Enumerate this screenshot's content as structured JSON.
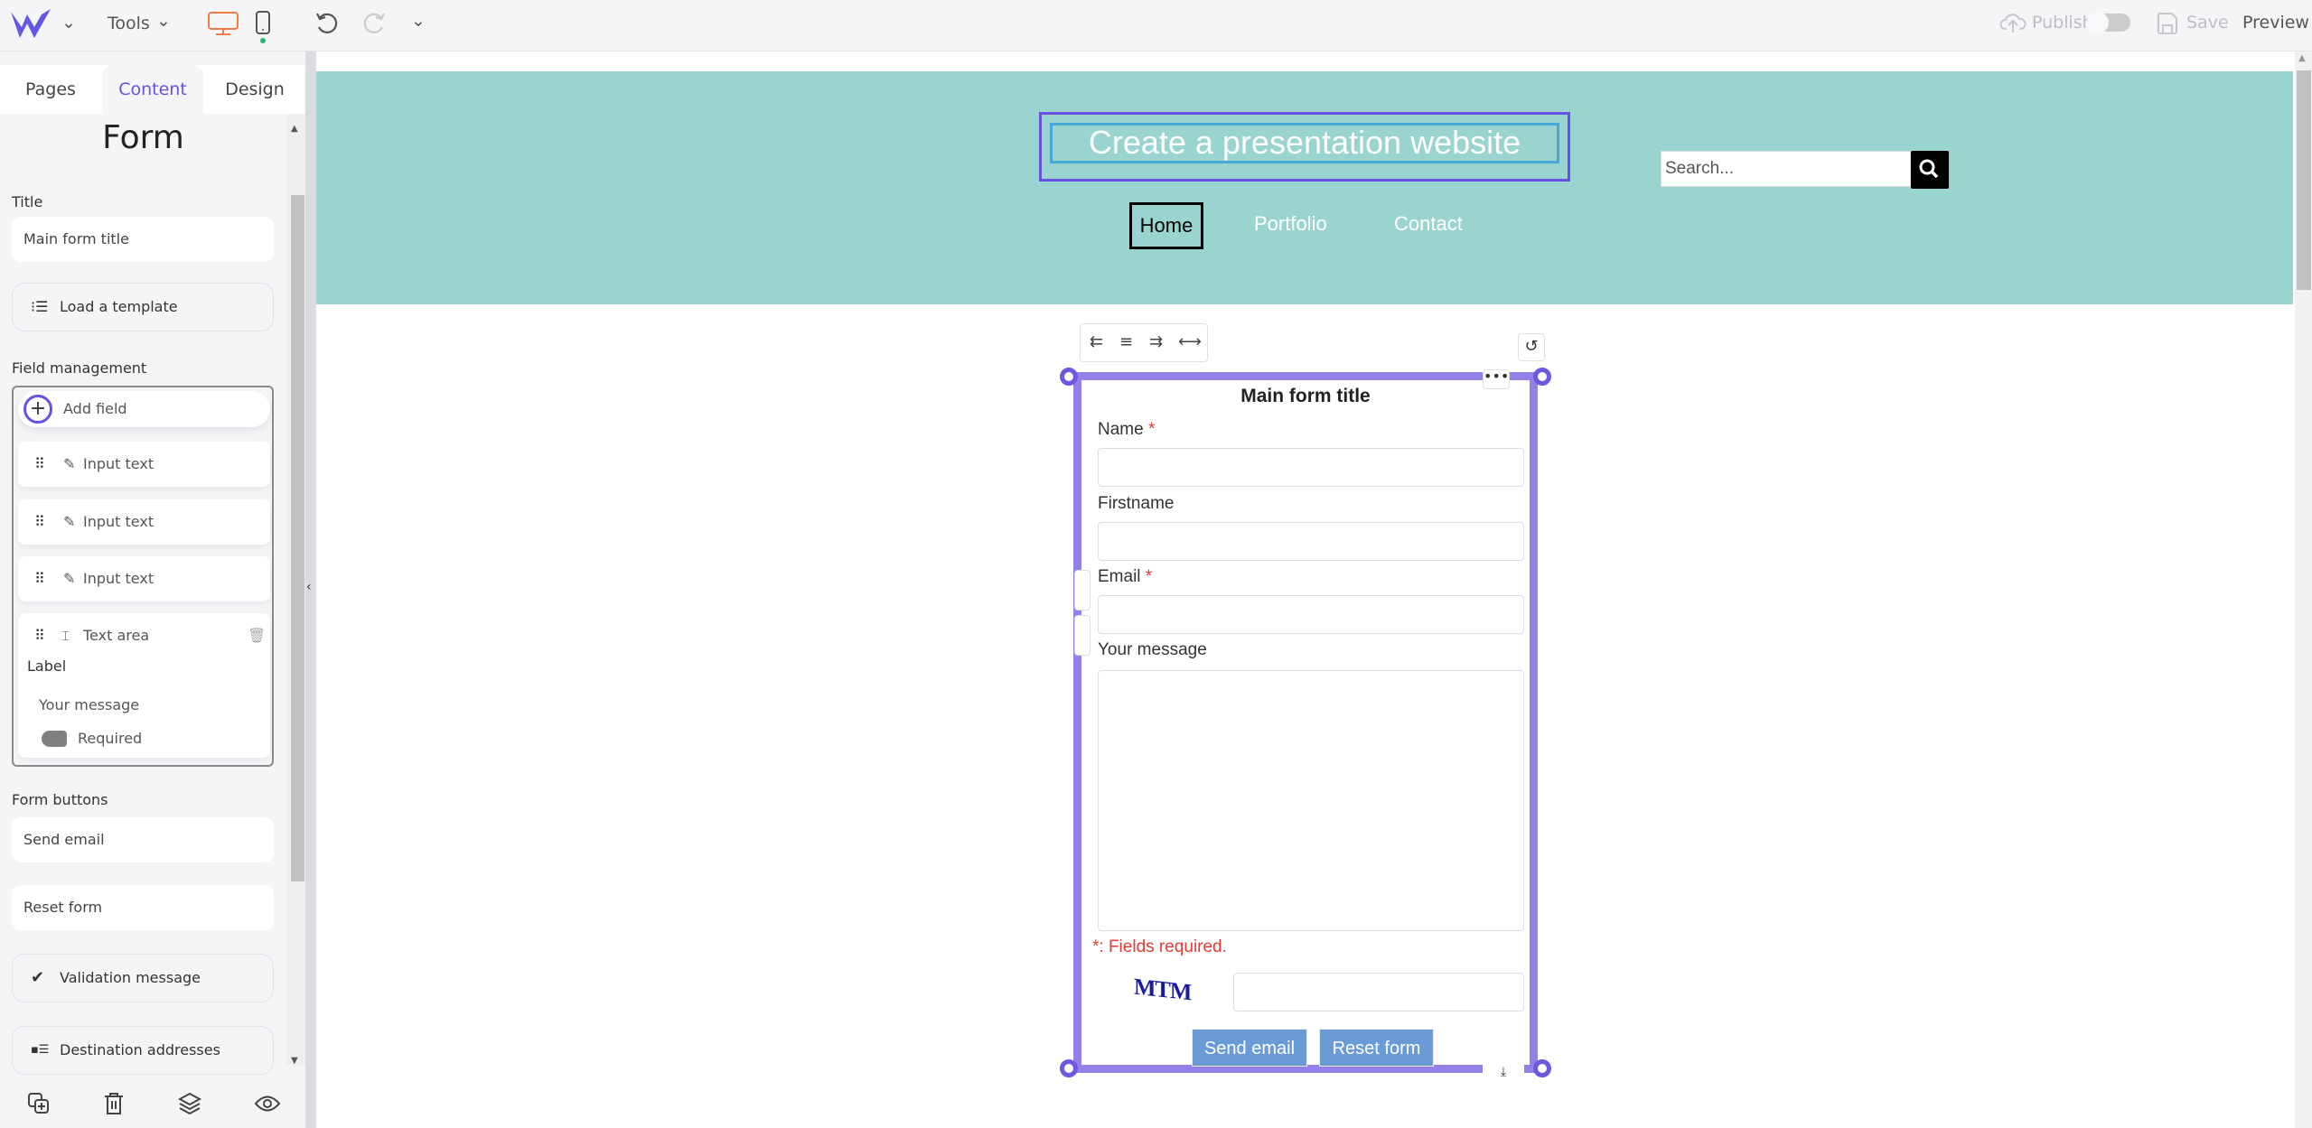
{
  "topbar": {
    "logo": "W",
    "tools_label": "Tools",
    "publish_label": "Publish",
    "save_label": "Save",
    "preview_label": "Preview",
    "device_desktop_color": "#f07c45",
    "device_mobile_indicator": "#2bb673"
  },
  "left_panel": {
    "tabs": [
      {
        "label": "Pages"
      },
      {
        "label": "Content",
        "active": true
      },
      {
        "label": "Design"
      }
    ],
    "title": "Form",
    "title_label": "Title",
    "title_value": "Main form title",
    "load_template": "Load a template",
    "field_management_label": "Field management",
    "add_field": "Add field",
    "fields": [
      {
        "type_label": "Input text",
        "icon": "pencil-icon"
      },
      {
        "type_label": "Input text",
        "icon": "pencil-icon"
      },
      {
        "type_label": "Input text",
        "icon": "pencil-icon"
      },
      {
        "type_label": "Text area",
        "icon": "textarea-icon",
        "expanded": true,
        "label_caption": "Label",
        "label_value": "Your message",
        "required_label": "Required",
        "required": false
      }
    ],
    "form_buttons_label": "Form buttons",
    "send_button_value": "Send email",
    "reset_button_value": "Reset form",
    "validation_message": "Validation message",
    "destination_addresses": "Destination addresses"
  },
  "site": {
    "title": "Create a presentation website",
    "search_placeholder": "Search...",
    "nav": [
      {
        "label": "Home",
        "active": true
      },
      {
        "label": "Portfolio"
      },
      {
        "label": "Contact"
      }
    ],
    "header_bg": "#99d4d1"
  },
  "form": {
    "title": "Main form title",
    "fields": [
      {
        "label": "Name",
        "required": true
      },
      {
        "label": "Firstname",
        "required": false
      },
      {
        "label": "Email",
        "required": true
      },
      {
        "label": "Your message",
        "required": false,
        "type": "textarea"
      }
    ],
    "required_star": "*",
    "required_note": "*: Fields required.",
    "captcha_text": "MTM",
    "send_label": "Send email",
    "reset_label": "Reset form",
    "frame_color": "#9580ea"
  }
}
